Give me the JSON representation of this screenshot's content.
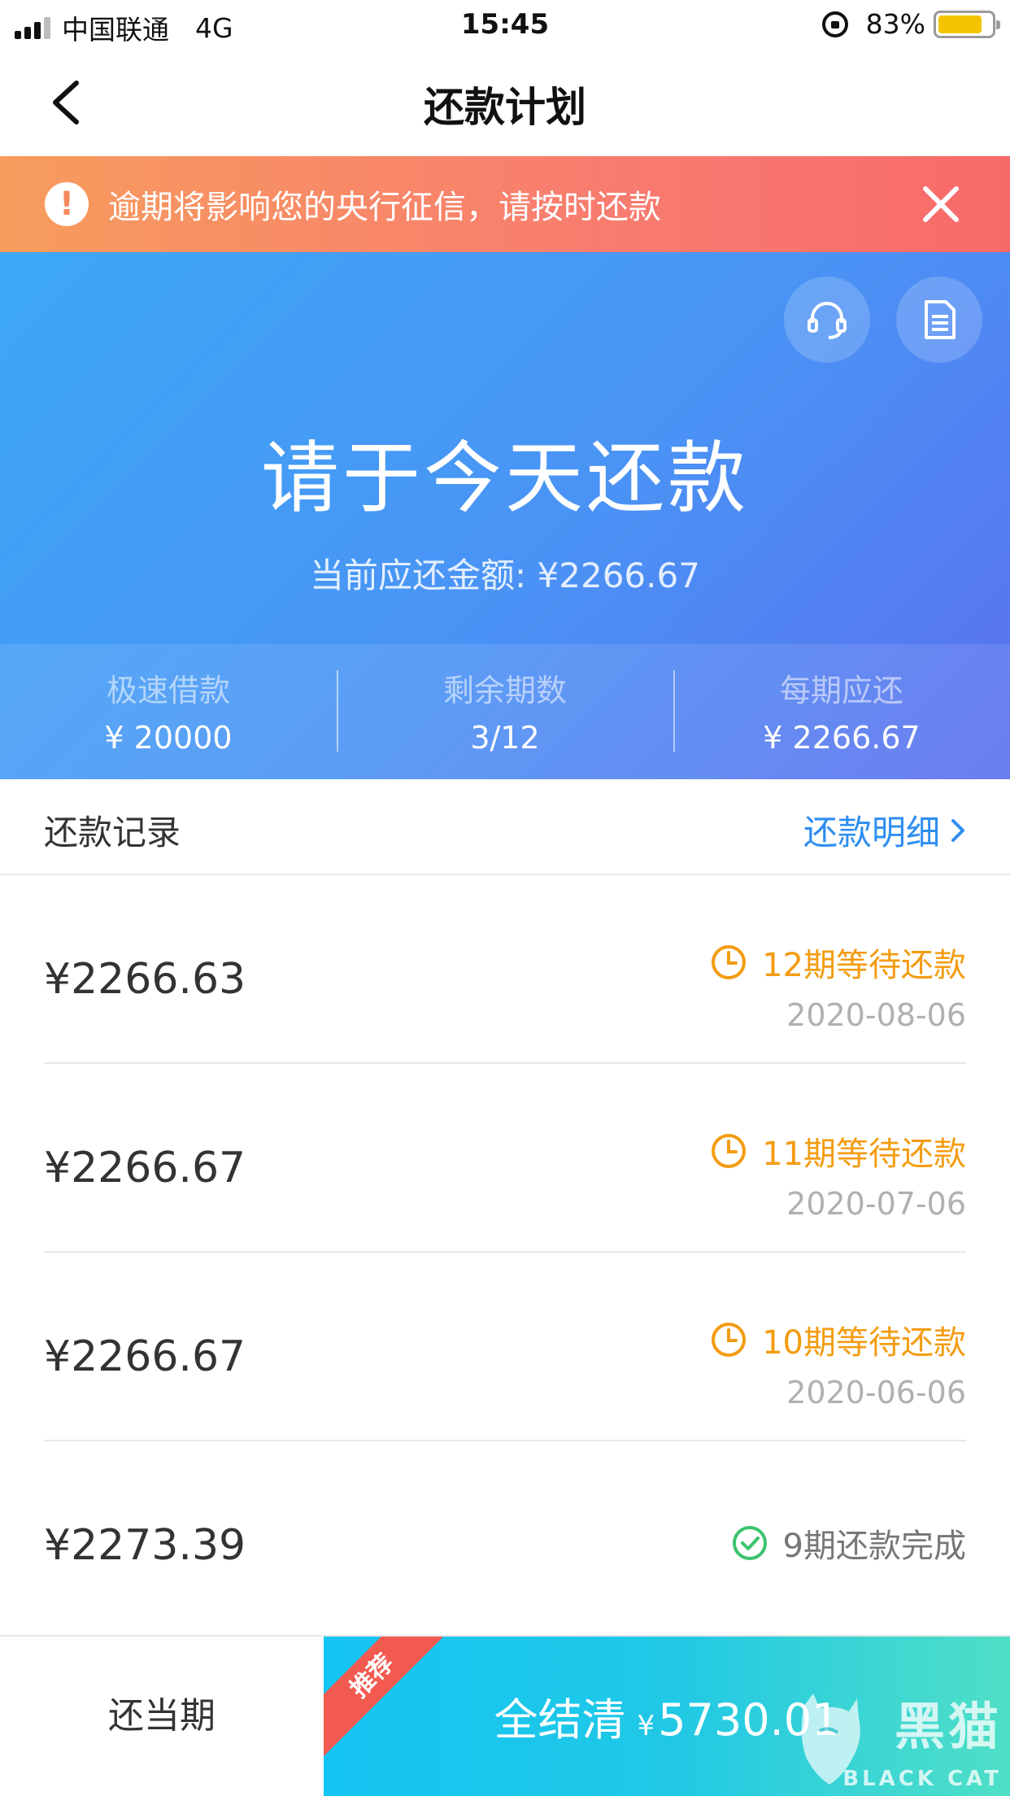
{
  "status_bar": {
    "carrier": "中国联通",
    "network": "4G",
    "time": "15:45",
    "battery": "83%",
    "battery_level": 0.83
  },
  "nav": {
    "title": "还款计划",
    "back_icon": "chevron-left-icon"
  },
  "warning": {
    "text": "逾期将影响您的央行征信，请按时还款",
    "icon": "exclamation-circle-icon",
    "close_icon": "close-icon"
  },
  "hero": {
    "title": "请于今天还款",
    "subtitle": "当前应还金额: ¥2266.67",
    "service_icon": "headset-icon",
    "doc_icon": "document-icon",
    "stats": [
      {
        "label": "极速借款",
        "value": "¥ 20000"
      },
      {
        "label": "剩余期数",
        "value": "3/12"
      },
      {
        "label": "每期应还",
        "value": "¥ 2266.67"
      }
    ]
  },
  "records": {
    "title": "还款记录",
    "detail_link": "还款明细",
    "items": [
      {
        "amount": "¥2266.63",
        "status": "12期等待还款",
        "date": "2020-08-06",
        "state": "pending"
      },
      {
        "amount": "¥2266.67",
        "status": "11期等待还款",
        "date": "2020-07-06",
        "state": "pending"
      },
      {
        "amount": "¥2266.67",
        "status": "10期等待还款",
        "date": "2020-06-06",
        "state": "pending"
      },
      {
        "amount": "¥2273.39",
        "status": "9期还款完成",
        "date": "",
        "state": "done"
      }
    ]
  },
  "bottom_bar": {
    "pay_current": "还当期",
    "pay_all_label": "全结清",
    "pay_all_currency": "¥",
    "pay_all_amount": "5730.01",
    "ribbon": "推荐",
    "watermark_text": "黑猫",
    "watermark_sub": "BLACK CAT"
  },
  "colors": {
    "accent_blue": "#2e8ef0",
    "pending_orange": "#f39c12",
    "done_green": "#3cc46e",
    "warning_bg": "#f87c6f"
  }
}
